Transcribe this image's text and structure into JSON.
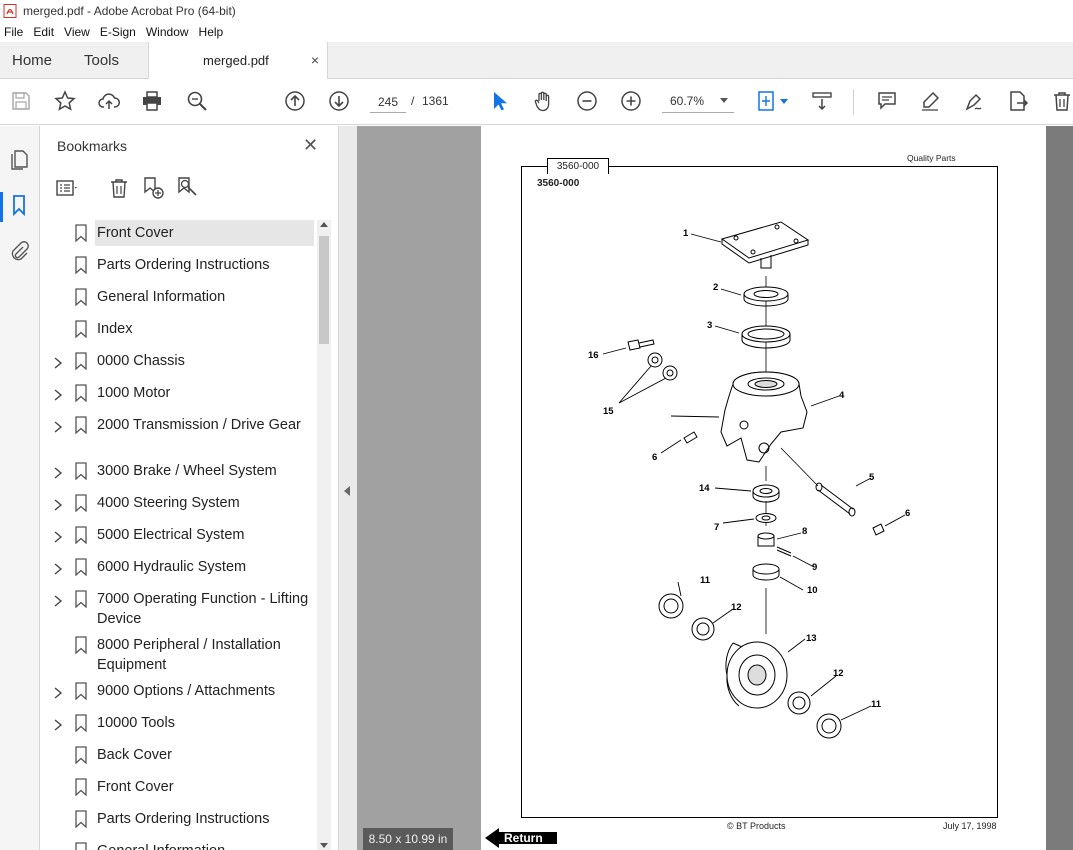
{
  "window": {
    "title": "merged.pdf - Adobe Acrobat Pro (64-bit)"
  },
  "menu": [
    "File",
    "Edit",
    "View",
    "E-Sign",
    "Window",
    "Help"
  ],
  "tabs": {
    "home": "Home",
    "tools": "Tools",
    "document": "merged.pdf",
    "close": "×"
  },
  "toolbar": {
    "page_current": "245",
    "page_sep": "/",
    "page_total": "1361",
    "zoom": "60.7%"
  },
  "bookmarks": {
    "header": "Bookmarks",
    "close": "✕",
    "items": [
      {
        "label": "Front Cover",
        "expandable": false,
        "selected": true
      },
      {
        "label": "Parts Ordering Instructions",
        "expandable": false
      },
      {
        "label": "General Information",
        "expandable": false
      },
      {
        "label": "Index",
        "expandable": false
      },
      {
        "label": "0000 Chassis",
        "expandable": true
      },
      {
        "label": "1000 Motor",
        "expandable": true
      },
      {
        "label": "2000 Transmission / Drive Gear",
        "expandable": true
      },
      {
        "label": "3000 Brake / Wheel System",
        "expandable": true
      },
      {
        "label": "4000 Steering System",
        "expandable": true
      },
      {
        "label": "5000 Electrical System",
        "expandable": true
      },
      {
        "label": "6000 Hydraulic System",
        "expandable": true
      },
      {
        "label": "7000 Operating Function - Lifting Device",
        "expandable": true
      },
      {
        "label": "8000 Peripheral / Installation Equipment",
        "expandable": false
      },
      {
        "label": "9000 Options / Attachments",
        "expandable": true
      },
      {
        "label": "10000 Tools",
        "expandable": true
      },
      {
        "label": "Back Cover",
        "expandable": false
      },
      {
        "label": "Front Cover",
        "expandable": false
      },
      {
        "label": "Parts Ordering Instructions",
        "expandable": false
      },
      {
        "label": "General Information",
        "expandable": false
      }
    ]
  },
  "document_page": {
    "tab_code": "3560-000",
    "header_right": "Quality Parts",
    "code": "3560-000",
    "footer_left": "© BT Products",
    "footer_right": "July 17, 1998",
    "callouts": [
      "1",
      "2",
      "3",
      "16",
      "15",
      "4",
      "6",
      "5",
      "6",
      "14",
      "7",
      "8",
      "9",
      "10",
      "11",
      "12",
      "13",
      "12",
      "11"
    ]
  },
  "page_size": "8.50 x 10.99 in",
  "return_label": "Return"
}
